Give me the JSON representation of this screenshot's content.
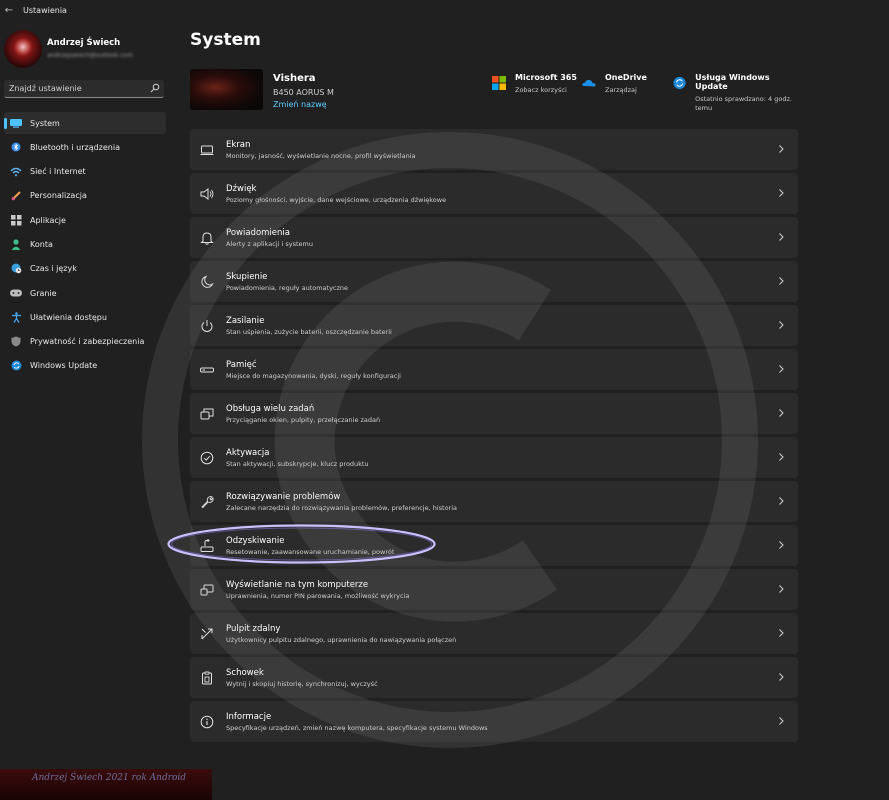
{
  "window": {
    "title": "Ustawienia"
  },
  "profile": {
    "name": "Andrzej Świech",
    "email": "andrzejswiech@outlook.com"
  },
  "search": {
    "placeholder": "Znajdź ustawienie"
  },
  "sidebar": {
    "items": [
      {
        "label": "System",
        "icon": "system-icon",
        "active": true
      },
      {
        "label": "Bluetooth i urządzenia",
        "icon": "bluetooth-icon"
      },
      {
        "label": "Sieć i Internet",
        "icon": "wifi-icon"
      },
      {
        "label": "Personalizacja",
        "icon": "brush-icon"
      },
      {
        "label": "Aplikacje",
        "icon": "apps-icon"
      },
      {
        "label": "Konta",
        "icon": "person-icon"
      },
      {
        "label": "Czas i język",
        "icon": "globe-clock-icon"
      },
      {
        "label": "Granie",
        "icon": "gamepad-icon"
      },
      {
        "label": "Ułatwienia dostępu",
        "icon": "accessibility-icon"
      },
      {
        "label": "Prywatność i zabezpieczenia",
        "icon": "shield-icon"
      },
      {
        "label": "Windows Update",
        "icon": "windows-update-icon"
      }
    ]
  },
  "logo_text": "Andrzej Świech 2021 rok Android",
  "page": {
    "title": "System"
  },
  "device": {
    "name": "Vishera",
    "model": "B450 AORUS M",
    "rename": "Zmień nazwę"
  },
  "quick": [
    {
      "title": "Microsoft 365",
      "sub": "Zobacz korzyści",
      "icon": "microsoft-logo-icon"
    },
    {
      "title": "OneDrive",
      "sub": "Zarządzaj",
      "icon": "onedrive-icon"
    },
    {
      "title": "Usługa Windows Update",
      "sub": "Ostatnio sprawdzano: 4 godz. temu",
      "icon": "windows-update-icon"
    }
  ],
  "cards": [
    {
      "title": "Ekran",
      "sub": "Monitory, jasność, wyświetlanie nocne, profil wyświetlania",
      "icon": "display-icon"
    },
    {
      "title": "Dźwięk",
      "sub": "Poziomy głośności, wyjście, dane wejściowe, urządzenia dźwiękowe",
      "icon": "speaker-icon"
    },
    {
      "title": "Powiadomienia",
      "sub": "Alerty z aplikacji i systemu",
      "icon": "bell-icon"
    },
    {
      "title": "Skupienie",
      "sub": "Powiadomienia, reguły automatyczne",
      "icon": "moon-icon"
    },
    {
      "title": "Zasilanie",
      "sub": "Stan uśpienia, zużycie baterii, oszczędzanie baterii",
      "icon": "power-icon"
    },
    {
      "title": "Pamięć",
      "sub": "Miejsce do magazynowania, dyski, reguły konfiguracji",
      "icon": "storage-icon"
    },
    {
      "title": "Obsługa wielu zadań",
      "sub": "Przyciąganie okien, pulpity, przełączanie zadań",
      "icon": "multitask-icon"
    },
    {
      "title": "Aktywacja",
      "sub": "Stan aktywacji, subskrypcje, klucz produktu",
      "icon": "check-circle-icon"
    },
    {
      "title": "Rozwiązywanie problemów",
      "sub": "Zalecane narzędzia do rozwiązywania problemów, preferencje, historia",
      "icon": "wrench-icon"
    },
    {
      "title": "Odzyskiwanie",
      "sub": "Resetowanie, zaawansowane uruchamianie, powrót",
      "icon": "recovery-icon"
    },
    {
      "title": "Wyświetlanie na tym komputerze",
      "sub": "Uprawnienia, numer PIN parowania, możliwość wykrycia",
      "icon": "project-icon"
    },
    {
      "title": "Pulpit zdalny",
      "sub": "Użytkownicy pulpitu zdalnego, uprawnienia do nawiązywania połączeń",
      "icon": "remote-desktop-icon"
    },
    {
      "title": "Schowek",
      "sub": "Wytnij i skopiuj historię, synchronizuj, wyczyść",
      "icon": "clipboard-icon"
    },
    {
      "title": "Informacje",
      "sub": "Specyfikacje urządzeń, zmień nazwę komputera, specyfikacje systemu Windows",
      "icon": "info-icon"
    }
  ],
  "colors": {
    "accent": "#4cc2ff",
    "link": "#60cdff",
    "card": "#2b2b2b",
    "background": "#202020"
  }
}
